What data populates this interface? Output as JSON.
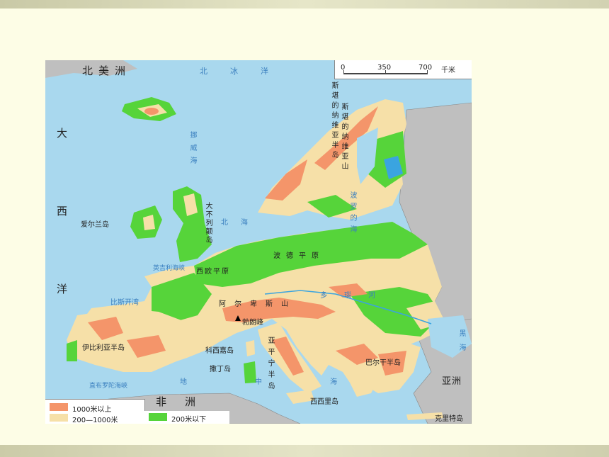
{
  "scale": {
    "t0": "0",
    "t1": "350",
    "t2": "700",
    "unit": "千米"
  },
  "legend": {
    "items": [
      {
        "label": "1000米以上",
        "color": "#f4956a"
      },
      {
        "label": "200—1000米",
        "color": "#f6e0a8"
      },
      {
        "label": "200米以下",
        "color": "#56d43a"
      }
    ]
  },
  "labels": {
    "north_america": "北美洲",
    "arctic_ocean": "北冰洋",
    "atlantic": [
      "大",
      "西",
      "洋"
    ],
    "norwegian_sea": "挪威海",
    "scandinavian_peninsula": "斯堪的纳维亚半岛",
    "scandinavian_mountains": "斯堪的纳维亚山",
    "great_britain": "大不列颠岛",
    "ireland": "爱尔兰岛",
    "north_sea": "北海",
    "baltic_sea": "波罗的海",
    "english_channel": "英吉利海峡",
    "polish_plain": "波德平原",
    "west_european_plain": "西欧平原",
    "bay_of_biscay": "比斯开湾",
    "alps": "阿尔卑斯山",
    "mont_blanc": "勃朗峰",
    "danube": "多瑙河",
    "iberian_peninsula": "伊比利亚半岛",
    "apennine_peninsula": "亚平宁半岛",
    "corsica": "科西嘉岛",
    "sardinia": "撒丁岛",
    "sicily": "西西里岛",
    "balkan_peninsula": "巴尔干半岛",
    "strait_of_gibraltar": "直布罗陀海峡",
    "mediterranean": "地中海",
    "africa": "非洲",
    "asia": "亚洲",
    "black_sea": "黑海",
    "crete": "克里特岛"
  }
}
